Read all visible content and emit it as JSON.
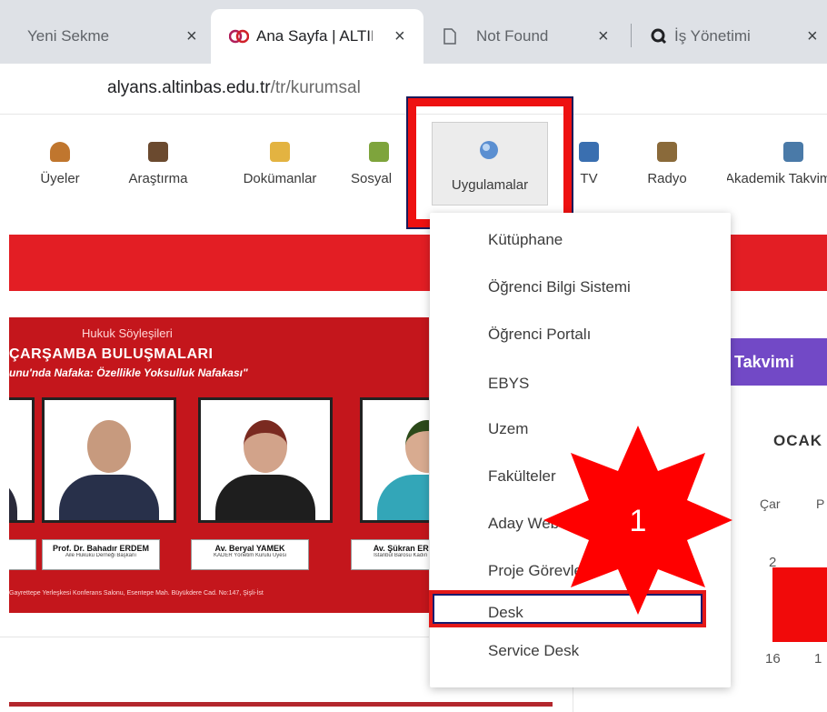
{
  "browser": {
    "tabs": [
      {
        "title": "Yeni Sekme",
        "close": "×"
      },
      {
        "title": "Ana Sayfa | ALTINBAŞ",
        "close": "×"
      },
      {
        "title": "Not Found",
        "close": "×"
      },
      {
        "title": "İş Yönetimi",
        "close": "×"
      }
    ],
    "url_host": "alyans.altinbas.edu.tr",
    "url_path": "/tr/kurumsal"
  },
  "nav": {
    "items": [
      {
        "label": "Üyeler",
        "icon": "users-icon",
        "color": "#c0762e"
      },
      {
        "label": "Araştırma",
        "icon": "books-icon",
        "color": "#6b4a2f"
      },
      {
        "label": "Dokümanlar",
        "icon": "documents-icon",
        "color": "#e3b341"
      },
      {
        "label": "Sosyal",
        "icon": "social-icon",
        "color": "#7ea43c"
      },
      {
        "label": "Uygulamalar",
        "icon": "apps-icon",
        "color": "#5b8fd1"
      },
      {
        "label": "TV",
        "icon": "tv-icon",
        "color": "#3a6fb0"
      },
      {
        "label": "Radyo",
        "icon": "radio-icon",
        "color": "#8a6a3a"
      },
      {
        "label": "Akademik Takvim",
        "icon": "calendar-icon",
        "color": "#4a7aa8"
      }
    ]
  },
  "hero": {
    "subtitle": "Hukuk Söyleşileri",
    "title": "ÇARŞAMBA BULUŞMALARI",
    "quote": "unu'nda Nafaka: Özellikle Yoksulluk Nafakası\"",
    "speakers": [
      {
        "name": "Prof. Dr. Bahadır ERDEM",
        "role": "Aile Hukuku Derneği Başkanı"
      },
      {
        "name": "Av. Beryal YAMEK",
        "role": "KADER Yönetim Kurulu Üyesi"
      },
      {
        "name": "Av. Şükran ERGÖZ",
        "role": "İstanbul Barosu Kadın Hakları"
      }
    ],
    "footer": "Gayrettepe Yerleşkesi Konferans Salonu, Esentepe Mah. Büyükdere Cad. No:147, Şişli-İst"
  },
  "calendar": {
    "header": "Takvimi",
    "month": "OCAK",
    "day_label": "Çar",
    "day_label2": "P",
    "date_2": "2",
    "date_16": "16",
    "date_1": "1"
  },
  "menu": {
    "items": [
      "Kütüphane",
      "Öğrenci Bilgi Sistemi",
      "Öğrenci Portalı",
      "EBYS",
      "Uzem",
      "Fakülteler",
      "Aday Web",
      "Proje Görevleri",
      "Desk",
      "Service Desk"
    ]
  },
  "callout": {
    "number": "1"
  },
  "colors": {
    "accent_red": "#e31e24",
    "purple": "#7249c6",
    "highlight": "#ee1111"
  }
}
